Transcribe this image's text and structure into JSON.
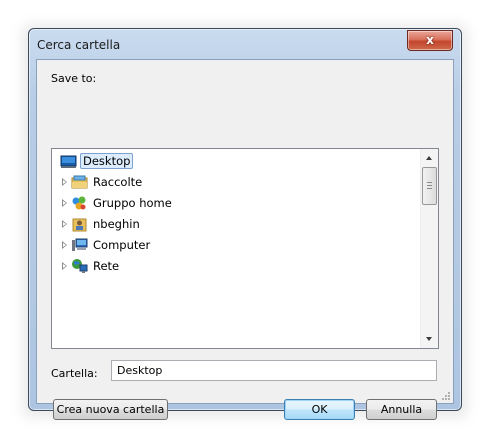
{
  "window": {
    "title": "Cerca cartella",
    "close_label": "x"
  },
  "dialog": {
    "save_to_label": "Save to:",
    "folder_label": "Cartella:",
    "folder_value": "Desktop"
  },
  "tree": {
    "items": [
      {
        "label": "Desktop",
        "icon": "desktop-icon",
        "selected": true
      },
      {
        "label": "Raccolte",
        "icon": "libraries-icon"
      },
      {
        "label": "Gruppo home",
        "icon": "homegroup-icon"
      },
      {
        "label": "nbeghin",
        "icon": "user-folder-icon"
      },
      {
        "label": "Computer",
        "icon": "computer-icon"
      },
      {
        "label": "Rete",
        "icon": "network-icon"
      }
    ]
  },
  "buttons": {
    "new_folder": "Crea nuova cartella",
    "ok": "OK",
    "cancel": "Annulla"
  }
}
